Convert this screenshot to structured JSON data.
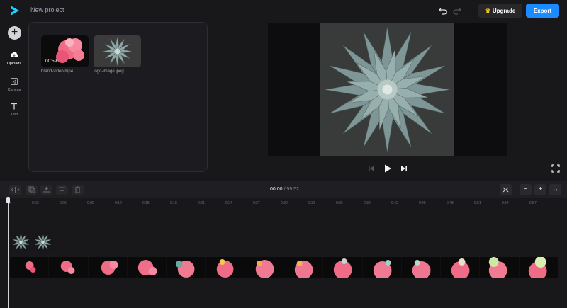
{
  "header": {
    "title": "New project",
    "upgrade_label": "Upgrade",
    "export_label": "Export",
    "icons": [
      "logo-icon",
      "undo-icon",
      "redo-icon",
      "crown-icon"
    ]
  },
  "rail": {
    "add_label": "+",
    "items": [
      {
        "label": "Uploads",
        "icon": "upload-icon",
        "active": true
      },
      {
        "label": "Canvas",
        "icon": "canvas-icon",
        "active": false
      },
      {
        "label": "Text",
        "icon": "text-icon",
        "active": false
      }
    ]
  },
  "media": {
    "items": [
      {
        "name": "brand-video.mp4",
        "duration": "00:59",
        "kind": "video"
      },
      {
        "name": "logo-image.jpeg",
        "kind": "image"
      }
    ]
  },
  "player": {
    "icons": [
      "skip-back-icon",
      "play-icon",
      "skip-forward-icon",
      "fullscreen-icon"
    ]
  },
  "timeline": {
    "current_time": "00.00",
    "separator": "/",
    "total_time": "59.52",
    "zoom_out": "−",
    "zoom_in": "+",
    "fit_label": "↔",
    "ruler": [
      "0",
      "0:03",
      "0:06",
      "0:09",
      "0:12",
      "0:15",
      "0:18",
      "0:21",
      "0:24",
      "0:27",
      "0:30",
      "0:33",
      "0:36",
      "0:39",
      "0:42",
      "0:45",
      "0:48",
      "0:51",
      "0:54",
      "0:57"
    ]
  },
  "colors": {
    "accent": "#1a8cff",
    "background": "#18181b",
    "panel": "#1c1c20"
  }
}
